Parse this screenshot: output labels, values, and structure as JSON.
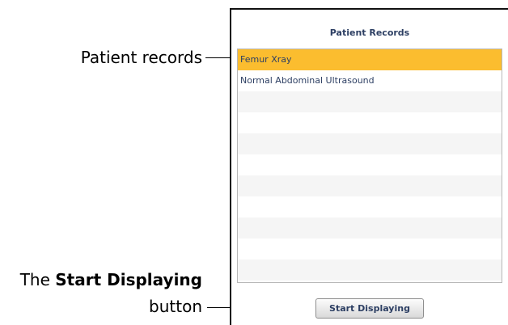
{
  "annotations": {
    "patient_records": "Patient records",
    "start_button_prefix": "The ",
    "start_button_bold": "Start Displaying",
    "start_button_suffix": "button"
  },
  "panel": {
    "title": "Patient Records",
    "records": [
      {
        "label": "Femur Xray",
        "selected": true
      },
      {
        "label": "Normal Abdominal Ultrasound",
        "selected": false
      },
      {
        "label": "",
        "selected": false
      },
      {
        "label": "",
        "selected": false
      },
      {
        "label": "",
        "selected": false
      },
      {
        "label": "",
        "selected": false
      },
      {
        "label": "",
        "selected": false
      },
      {
        "label": "",
        "selected": false
      },
      {
        "label": "",
        "selected": false
      },
      {
        "label": "",
        "selected": false
      },
      {
        "label": "",
        "selected": false
      }
    ],
    "button_label": "Start Displaying"
  },
  "colors": {
    "selected_row": "#fbbd2f",
    "text_blue": "#2d3f63"
  }
}
